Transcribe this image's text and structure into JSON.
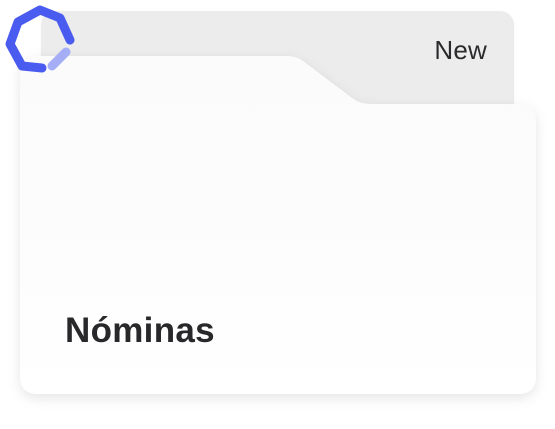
{
  "card": {
    "badge_label": "New",
    "title": "Nóminas"
  },
  "icons": {
    "logo": "hexagon-ring-logo-icon"
  },
  "colors": {
    "back_tab": "#ececec",
    "folder_front": "#fcfcfc",
    "title_text": "#28282b",
    "logo_primary": "#4a5cf0",
    "logo_accent": "#a5adf7"
  }
}
